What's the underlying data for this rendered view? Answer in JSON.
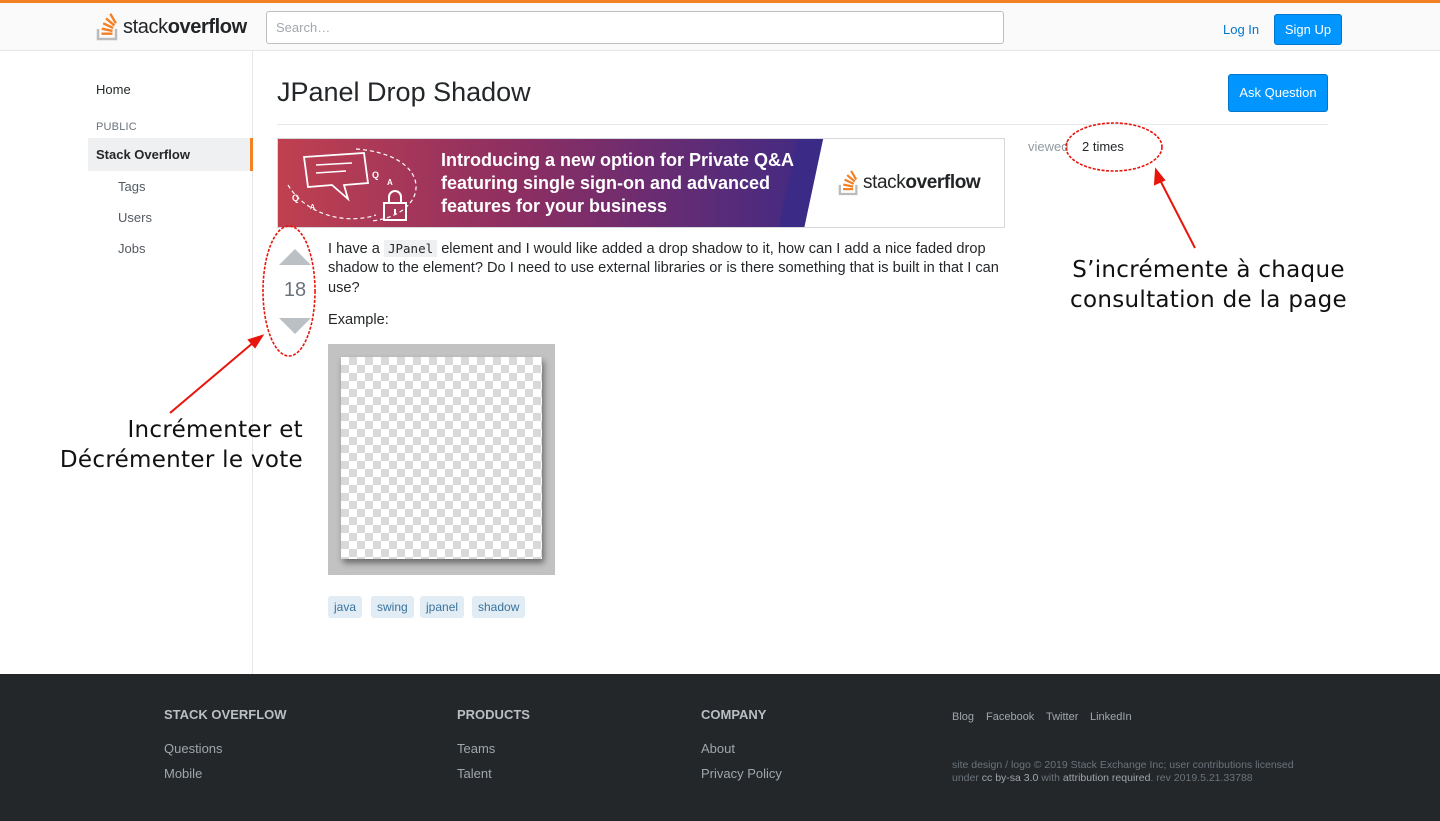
{
  "header": {
    "logo_regular": "stack",
    "logo_bold": "overflow",
    "search_placeholder": "Search…",
    "login_label": "Log In",
    "signup_label": "Sign Up"
  },
  "sidebar": {
    "home": "Home",
    "section_label": "PUBLIC",
    "active_item": "Stack Overflow",
    "sub_items": [
      "Tags",
      "Users",
      "Jobs"
    ]
  },
  "question": {
    "title": "JPanel Drop Shadow",
    "ask_button": "Ask Question",
    "banner_headline": "Introducing a new option for Private Q&A featuring single sign-on and advanced features for your business",
    "banner_logo_regular": "stack",
    "banner_logo_bold": "overflow",
    "vote_count": "18",
    "body_part1": "I have a ",
    "body_code": "JPanel",
    "body_part2": " element and I would like added a drop shadow to it, how can I add a nice faded drop shadow to the element? Do I need to use external libraries or is there something that is built in that I can use?",
    "example_label": "Example:",
    "tags": [
      "java",
      "swing",
      "jpanel",
      "shadow"
    ],
    "viewed_label": "viewed",
    "viewed_value": "2 times"
  },
  "annotations": {
    "vote_line1": "Incrémenter et",
    "vote_line2": "Décrémenter le vote",
    "views_line1": "S’incrémente à chaque",
    "views_line2": "consultation de la page",
    "color": "#e8150c"
  },
  "footer": {
    "col1_heading": "STACK OVERFLOW",
    "col1_links": [
      "Questions",
      "Mobile"
    ],
    "col2_heading": "PRODUCTS",
    "col2_links": [
      "Teams",
      "Talent"
    ],
    "col3_heading": "COMPANY",
    "col3_links": [
      "About",
      "Privacy Policy"
    ],
    "social": [
      "Blog",
      "Facebook",
      "Twitter",
      "LinkedIn"
    ],
    "legal_part1": "site design / logo © 2019 Stack Exchange Inc; user contributions licensed under ",
    "legal_link1": "cc by-sa 3.0",
    "legal_part2": " with ",
    "legal_link2": "attribution required",
    "legal_part3": ". rev 2019.5.21.33788"
  },
  "colors": {
    "accent_orange": "#f48024",
    "primary_blue": "#0095ff",
    "tag_bg": "#e1ecf4",
    "footer_bg": "#242729"
  }
}
